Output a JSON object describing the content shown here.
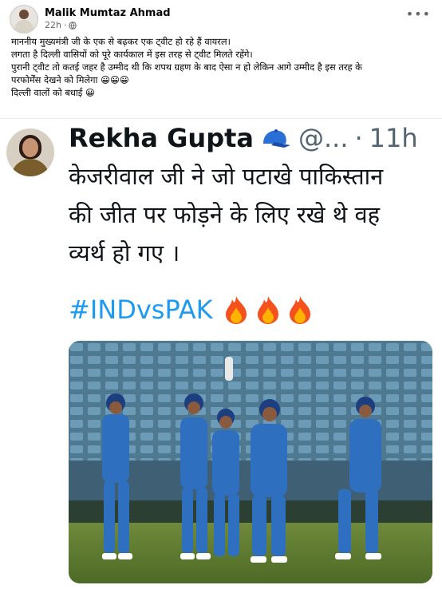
{
  "post": {
    "author": "Malik Mumtaz Ahmad",
    "time": "22h",
    "caption_lines": [
      "माननीय मुख्यमंत्री जी के एक से बढ़कर एक ट्वीट हो रहे हैं वायरल।",
      "लगता है दिल्ली वासियों को पूरे कार्यकाल में इस तरह से ट्वीट मिलते रहेंगे।",
      "पुरानी ट्वीट तो कतई जहर है उम्मीद थी कि शपथ ग्रहण के बाद ऐसा न हो लेकिन आगे उम्मीद है इस तरह के",
      "परफोर्मेंस देखने को मिलेगा 😀😀😀",
      "दिल्ली वालों को बधाई 😀"
    ]
  },
  "tweet": {
    "name": "Rekha Gupta",
    "handle": "@...",
    "separator": "·",
    "time": "11h",
    "text_lines": [
      "केजरीवाल जी ने जो पटाखे पाकिस्तान",
      "की जीत पर फोड़ने के लिए रखे थे वह",
      "व्यर्थ हो गए ।"
    ],
    "hashtag": "#INDvsPAK"
  },
  "icons": {
    "globe": "globe-icon",
    "more": "more-options-icon",
    "badge": "cap-emoji-icon",
    "fire": "fire-emoji-icon"
  },
  "colors": {
    "link_blue": "#1d9bf0",
    "secondary_text": "#65676b",
    "jersey_blue": "#2f6fc0"
  }
}
